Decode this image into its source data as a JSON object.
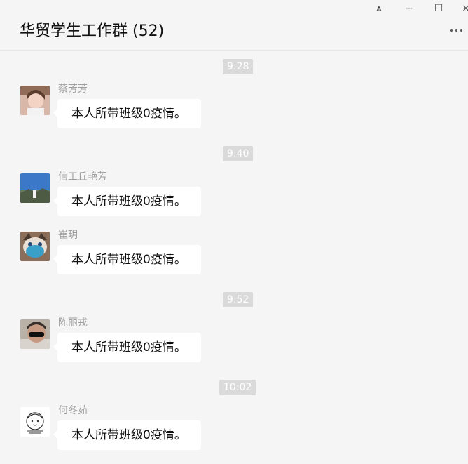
{
  "header": {
    "title": "华贸学生工作群 (52)"
  },
  "window_controls": {
    "pin": "⩚",
    "minimize": "−",
    "maximize": "☐",
    "close": "×"
  },
  "messages": [
    {
      "time": "9:28",
      "sender": "蔡芳芳",
      "text": "本人所带班级0疫情。"
    },
    {
      "time": "9:40",
      "sender": "信工丘艳芳",
      "text": "本人所带班级0疫情。"
    },
    {
      "sender": "崔玥",
      "text": "本人所带班级0疫情。"
    },
    {
      "time": "9:52",
      "sender": "陈丽戎",
      "text": "本人所带班级0疫情。"
    },
    {
      "time": "10:02",
      "sender": "何冬茹",
      "text": "本人所带班级0疫情。"
    }
  ]
}
